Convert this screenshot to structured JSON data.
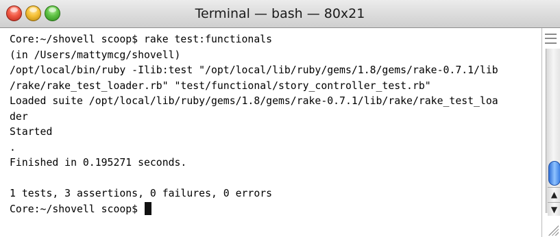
{
  "window": {
    "title": "Terminal — bash — 80x21",
    "controls": {
      "close_icon": "close-icon",
      "minimize_icon": "minimize-icon",
      "zoom_icon": "zoom-icon"
    }
  },
  "terminal": {
    "lines": [
      "Core:~/shovell scoop$ rake test:functionals",
      "(in /Users/mattymcg/shovell)",
      "/opt/local/bin/ruby -Ilib:test \"/opt/local/lib/ruby/gems/1.8/gems/rake-0.7.1/lib",
      "/rake/rake_test_loader.rb\" \"test/functional/story_controller_test.rb\"",
      "Loaded suite /opt/local/lib/ruby/gems/1.8/gems/rake-0.7.1/lib/rake/rake_test_loa",
      "der",
      "Started",
      ".",
      "Finished in 0.195271 seconds.",
      "",
      "1 tests, 3 assertions, 0 failures, 0 errors"
    ],
    "prompt": "Core:~/shovell scoop$ "
  },
  "scrollbar": {
    "up_arrow": "▲",
    "down_arrow": "▼",
    "scroll_position": 0.95
  },
  "colors": {
    "text": "#000000",
    "background": "#ffffff",
    "scroll_thumb": "#3b7fe4"
  }
}
